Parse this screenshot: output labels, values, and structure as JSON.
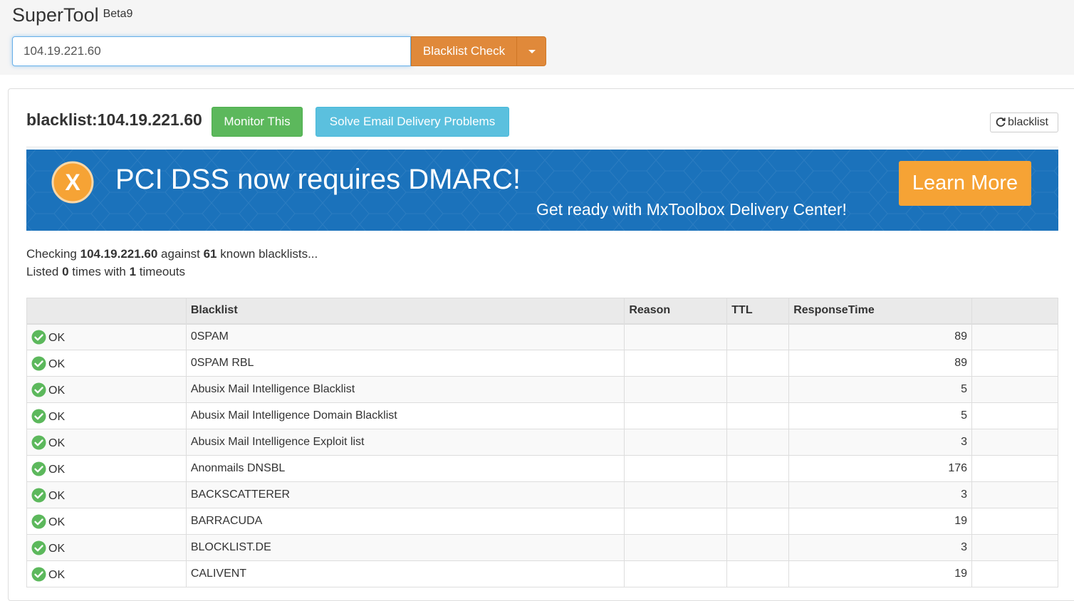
{
  "brand": {
    "name": "SuperTool",
    "version": "Beta9"
  },
  "search": {
    "value": "104.19.221.60",
    "button_label": "Blacklist Check"
  },
  "header": {
    "title": "blacklist:104.19.221.60",
    "monitor_label": "Monitor This",
    "solve_label": "Solve Email Delivery Problems",
    "refresh_label": "blacklist"
  },
  "banner": {
    "headline": "PCI DSS now requires DMARC!",
    "subtext": "Get ready with MxToolbox Delivery Center!",
    "cta_label": "Learn More",
    "logo_letter": "X"
  },
  "summary": {
    "checking_prefix": "Checking ",
    "ip": "104.19.221.60",
    "against": " against ",
    "count": "61",
    "known_suffix": " known blacklists...",
    "listed_prefix": "Listed ",
    "listed_count": "0",
    "times_with": " times with ",
    "timeouts_count": "1",
    "timeouts_suffix": " timeouts"
  },
  "table": {
    "headers": [
      "",
      "Blacklist",
      "Reason",
      "TTL",
      "ResponseTime",
      ""
    ],
    "rows": [
      {
        "status": "OK",
        "blacklist": "0SPAM",
        "reason": "",
        "ttl": "",
        "response": "89"
      },
      {
        "status": "OK",
        "blacklist": "0SPAM RBL",
        "reason": "",
        "ttl": "",
        "response": "89"
      },
      {
        "status": "OK",
        "blacklist": "Abusix Mail Intelligence Blacklist",
        "reason": "",
        "ttl": "",
        "response": "5"
      },
      {
        "status": "OK",
        "blacklist": "Abusix Mail Intelligence Domain Blacklist",
        "reason": "",
        "ttl": "",
        "response": "5"
      },
      {
        "status": "OK",
        "blacklist": "Abusix Mail Intelligence Exploit list",
        "reason": "",
        "ttl": "",
        "response": "3"
      },
      {
        "status": "OK",
        "blacklist": "Anonmails DNSBL",
        "reason": "",
        "ttl": "",
        "response": "176"
      },
      {
        "status": "OK",
        "blacklist": "BACKSCATTERER",
        "reason": "",
        "ttl": "",
        "response": "3"
      },
      {
        "status": "OK",
        "blacklist": "BARRACUDA",
        "reason": "",
        "ttl": "",
        "response": "19"
      },
      {
        "status": "OK",
        "blacklist": "BLOCKLIST.DE",
        "reason": "",
        "ttl": "",
        "response": "3"
      },
      {
        "status": "OK",
        "blacklist": "CALIVENT",
        "reason": "",
        "ttl": "",
        "response": "19"
      }
    ]
  },
  "icons": {
    "status_ok": "check-circle-icon",
    "refresh": "refresh-icon",
    "dropdown": "caret-down-icon"
  },
  "colors": {
    "primary_orange": "#e0893a",
    "success_green": "#5cb85c",
    "info_blue": "#5bc0de",
    "banner_blue": "#1b72bb",
    "cta_orange": "#f6a335",
    "ok_green": "#5cb85c"
  }
}
